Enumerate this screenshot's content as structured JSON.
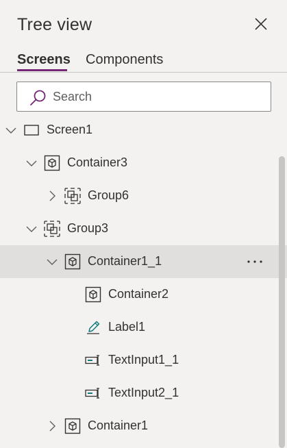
{
  "header": {
    "title": "Tree view",
    "close_icon": "close-icon"
  },
  "tabs": [
    {
      "label": "Screens",
      "active": true
    },
    {
      "label": "Components",
      "active": false
    }
  ],
  "search": {
    "placeholder": "Search",
    "value": ""
  },
  "accent_color": "#742774",
  "tree": {
    "nodes": [
      {
        "label": "Screen1",
        "icon": "screen-icon",
        "expander": "expanded",
        "depth": 0,
        "selected": false
      },
      {
        "label": "Container3",
        "icon": "container-icon",
        "expander": "expanded",
        "depth": 1,
        "selected": false
      },
      {
        "label": "Group6",
        "icon": "group-icon",
        "expander": "collapsed",
        "depth": 2,
        "selected": false
      },
      {
        "label": "Group3",
        "icon": "group-icon",
        "expander": "expanded",
        "depth": 1,
        "selected": false
      },
      {
        "label": "Container1_1",
        "icon": "container-icon",
        "expander": "expanded",
        "depth": 2,
        "selected": true
      },
      {
        "label": "Container2",
        "icon": "container-icon",
        "expander": "none",
        "depth": 3,
        "selected": false
      },
      {
        "label": "Label1",
        "icon": "label-icon",
        "expander": "none",
        "depth": 3,
        "selected": false
      },
      {
        "label": "TextInput1_1",
        "icon": "text-input-icon",
        "expander": "none",
        "depth": 3,
        "selected": false
      },
      {
        "label": "TextInput2_1",
        "icon": "text-input-icon",
        "expander": "none",
        "depth": 3,
        "selected": false
      },
      {
        "label": "Container1",
        "icon": "container-icon",
        "expander": "collapsed",
        "depth": 2,
        "selected": false
      }
    ],
    "selected_more_icon": "more-icon"
  }
}
